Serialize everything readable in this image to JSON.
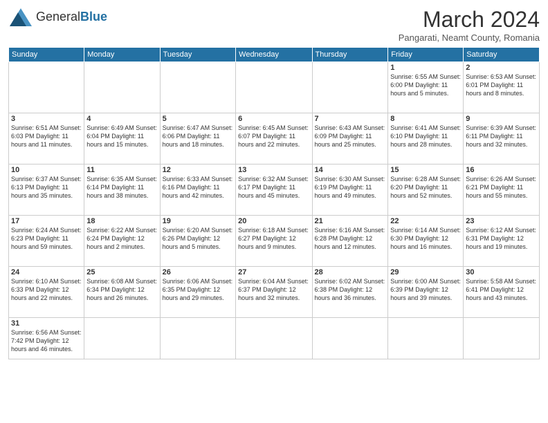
{
  "header": {
    "logo_general": "General",
    "logo_blue": "Blue",
    "title": "March 2024",
    "location": "Pangarati, Neamt County, Romania"
  },
  "days_of_week": [
    "Sunday",
    "Monday",
    "Tuesday",
    "Wednesday",
    "Thursday",
    "Friday",
    "Saturday"
  ],
  "weeks": [
    [
      {
        "day": "",
        "info": ""
      },
      {
        "day": "",
        "info": ""
      },
      {
        "day": "",
        "info": ""
      },
      {
        "day": "",
        "info": ""
      },
      {
        "day": "",
        "info": ""
      },
      {
        "day": "1",
        "info": "Sunrise: 6:55 AM\nSunset: 6:00 PM\nDaylight: 11 hours\nand 5 minutes."
      },
      {
        "day": "2",
        "info": "Sunrise: 6:53 AM\nSunset: 6:01 PM\nDaylight: 11 hours\nand 8 minutes."
      }
    ],
    [
      {
        "day": "3",
        "info": "Sunrise: 6:51 AM\nSunset: 6:03 PM\nDaylight: 11 hours\nand 11 minutes."
      },
      {
        "day": "4",
        "info": "Sunrise: 6:49 AM\nSunset: 6:04 PM\nDaylight: 11 hours\nand 15 minutes."
      },
      {
        "day": "5",
        "info": "Sunrise: 6:47 AM\nSunset: 6:06 PM\nDaylight: 11 hours\nand 18 minutes."
      },
      {
        "day": "6",
        "info": "Sunrise: 6:45 AM\nSunset: 6:07 PM\nDaylight: 11 hours\nand 22 minutes."
      },
      {
        "day": "7",
        "info": "Sunrise: 6:43 AM\nSunset: 6:09 PM\nDaylight: 11 hours\nand 25 minutes."
      },
      {
        "day": "8",
        "info": "Sunrise: 6:41 AM\nSunset: 6:10 PM\nDaylight: 11 hours\nand 28 minutes."
      },
      {
        "day": "9",
        "info": "Sunrise: 6:39 AM\nSunset: 6:11 PM\nDaylight: 11 hours\nand 32 minutes."
      }
    ],
    [
      {
        "day": "10",
        "info": "Sunrise: 6:37 AM\nSunset: 6:13 PM\nDaylight: 11 hours\nand 35 minutes."
      },
      {
        "day": "11",
        "info": "Sunrise: 6:35 AM\nSunset: 6:14 PM\nDaylight: 11 hours\nand 38 minutes."
      },
      {
        "day": "12",
        "info": "Sunrise: 6:33 AM\nSunset: 6:16 PM\nDaylight: 11 hours\nand 42 minutes."
      },
      {
        "day": "13",
        "info": "Sunrise: 6:32 AM\nSunset: 6:17 PM\nDaylight: 11 hours\nand 45 minutes."
      },
      {
        "day": "14",
        "info": "Sunrise: 6:30 AM\nSunset: 6:19 PM\nDaylight: 11 hours\nand 49 minutes."
      },
      {
        "day": "15",
        "info": "Sunrise: 6:28 AM\nSunset: 6:20 PM\nDaylight: 11 hours\nand 52 minutes."
      },
      {
        "day": "16",
        "info": "Sunrise: 6:26 AM\nSunset: 6:21 PM\nDaylight: 11 hours\nand 55 minutes."
      }
    ],
    [
      {
        "day": "17",
        "info": "Sunrise: 6:24 AM\nSunset: 6:23 PM\nDaylight: 11 hours\nand 59 minutes."
      },
      {
        "day": "18",
        "info": "Sunrise: 6:22 AM\nSunset: 6:24 PM\nDaylight: 12 hours\nand 2 minutes."
      },
      {
        "day": "19",
        "info": "Sunrise: 6:20 AM\nSunset: 6:26 PM\nDaylight: 12 hours\nand 5 minutes."
      },
      {
        "day": "20",
        "info": "Sunrise: 6:18 AM\nSunset: 6:27 PM\nDaylight: 12 hours\nand 9 minutes."
      },
      {
        "day": "21",
        "info": "Sunrise: 6:16 AM\nSunset: 6:28 PM\nDaylight: 12 hours\nand 12 minutes."
      },
      {
        "day": "22",
        "info": "Sunrise: 6:14 AM\nSunset: 6:30 PM\nDaylight: 12 hours\nand 16 minutes."
      },
      {
        "day": "23",
        "info": "Sunrise: 6:12 AM\nSunset: 6:31 PM\nDaylight: 12 hours\nand 19 minutes."
      }
    ],
    [
      {
        "day": "24",
        "info": "Sunrise: 6:10 AM\nSunset: 6:33 PM\nDaylight: 12 hours\nand 22 minutes."
      },
      {
        "day": "25",
        "info": "Sunrise: 6:08 AM\nSunset: 6:34 PM\nDaylight: 12 hours\nand 26 minutes."
      },
      {
        "day": "26",
        "info": "Sunrise: 6:06 AM\nSunset: 6:35 PM\nDaylight: 12 hours\nand 29 minutes."
      },
      {
        "day": "27",
        "info": "Sunrise: 6:04 AM\nSunset: 6:37 PM\nDaylight: 12 hours\nand 32 minutes."
      },
      {
        "day": "28",
        "info": "Sunrise: 6:02 AM\nSunset: 6:38 PM\nDaylight: 12 hours\nand 36 minutes."
      },
      {
        "day": "29",
        "info": "Sunrise: 6:00 AM\nSunset: 6:39 PM\nDaylight: 12 hours\nand 39 minutes."
      },
      {
        "day": "30",
        "info": "Sunrise: 5:58 AM\nSunset: 6:41 PM\nDaylight: 12 hours\nand 43 minutes."
      }
    ],
    [
      {
        "day": "31",
        "info": "Sunrise: 6:56 AM\nSunset: 7:42 PM\nDaylight: 12 hours\nand 46 minutes."
      },
      {
        "day": "",
        "info": ""
      },
      {
        "day": "",
        "info": ""
      },
      {
        "day": "",
        "info": ""
      },
      {
        "day": "",
        "info": ""
      },
      {
        "day": "",
        "info": ""
      },
      {
        "day": "",
        "info": ""
      }
    ]
  ]
}
